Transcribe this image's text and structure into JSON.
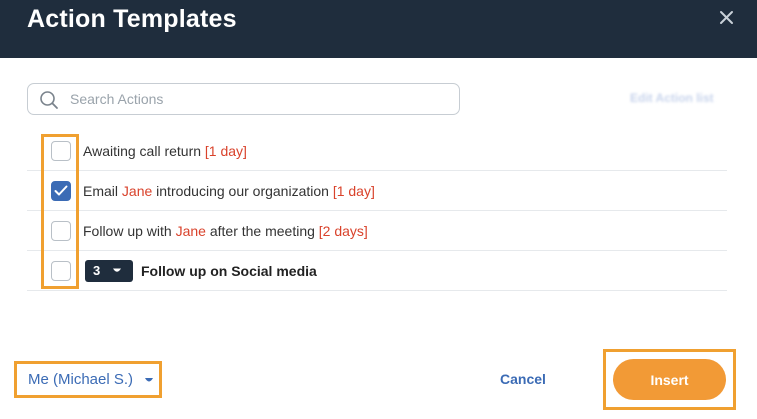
{
  "dialog": {
    "title": "Action Templates"
  },
  "search": {
    "placeholder": "Search Actions",
    "value": ""
  },
  "edit_link": "Edit Action list",
  "actions": [
    {
      "checked": false,
      "parts": [
        {
          "text": "Awaiting call return ",
          "highlight": false
        },
        {
          "text": "[1 day]",
          "highlight": true
        }
      ]
    },
    {
      "checked": true,
      "parts": [
        {
          "text": "Email ",
          "highlight": false
        },
        {
          "text": "Jane",
          "highlight": true
        },
        {
          "text": " introducing our organization ",
          "highlight": false
        },
        {
          "text": "[1 day]",
          "highlight": true
        }
      ]
    },
    {
      "checked": false,
      "parts": [
        {
          "text": "Follow up with ",
          "highlight": false
        },
        {
          "text": "Jane",
          "highlight": true
        },
        {
          "text": " after the meeting ",
          "highlight": false
        },
        {
          "text": "[2 days]",
          "highlight": true
        }
      ]
    }
  ],
  "group_action": {
    "checked": false,
    "count": "3",
    "label": "Follow up on Social media"
  },
  "footer": {
    "owner": "Me (Michael S.)",
    "cancel_label": "Cancel",
    "insert_label": "Insert"
  },
  "colors": {
    "header_bg": "#1f2d3d",
    "accent": "#3b6bb5",
    "highlight_text": "#d9422b",
    "insert_button": "#f29a36",
    "annotation_outline": "#f0a030"
  },
  "icons": {
    "close": "close-icon",
    "search": "search-icon",
    "checkmark": "checkmark-icon",
    "caret": "caret-down-icon"
  }
}
